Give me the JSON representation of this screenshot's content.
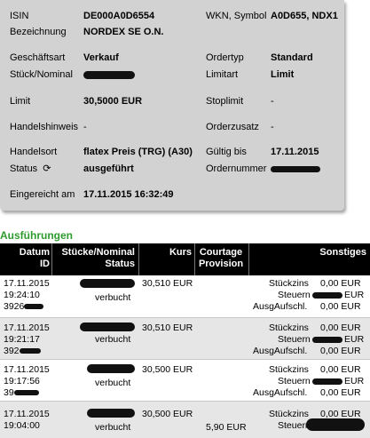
{
  "detail": {
    "isin_label": "ISIN",
    "isin_value": "DE000A0D6554",
    "wkn_label": "WKN, Symbol",
    "wkn_value": "A0D655, NDX1",
    "bezeichnung_label": "Bezeichnung",
    "bezeichnung_value": "NORDEX SE O.N.",
    "geschaeftsart_label": "Geschäftsart",
    "geschaeftsart_value": "Verkauf",
    "ordertyp_label": "Ordertyp",
    "ordertyp_value": "Standard",
    "stueck_label": "Stück/Nominal",
    "limitart_label": "Limitart",
    "limitart_value": "Limit",
    "limit_label": "Limit",
    "limit_value": "30,5000 EUR",
    "stoplimit_label": "Stoplimit",
    "stoplimit_value": "-",
    "handelshinweis_label": "Handelshinweis",
    "handelshinweis_value": "-",
    "orderzusatz_label": "Orderzusatz",
    "orderzusatz_value": "-",
    "handelsort_label": "Handelsort",
    "handelsort_value": "flatex Preis (TRG) (A30)",
    "gueltig_label": "Gültig bis",
    "gueltig_value": "17.11.2015",
    "status_label": "Status",
    "status_value": "ausgeführt",
    "ordernummer_label": "Ordernummer",
    "eingereicht_label": "Eingereicht am",
    "eingereicht_value": "17.11.2015 16:32:49",
    "status_icon": "refresh-icon"
  },
  "executions": {
    "title": "Ausführungen",
    "headers": {
      "datum": "Datum",
      "id": "ID",
      "stuecke": "Stücke/Nominal",
      "status": "Status",
      "kurs": "Kurs",
      "courtage": "Courtage",
      "provision": "Provision",
      "sonstiges": "Sonstiges"
    },
    "rows": [
      {
        "date": "17.11.2015",
        "time": "19:24:10",
        "id_prefix": "3926",
        "status": "verbucht",
        "kurs": "30,510 EUR",
        "courtage": "",
        "stueckzins_label": "Stückzins",
        "stueckzins_value": "0,00 EUR",
        "steuern_label": "Steuern",
        "steuern_value": "EUR",
        "ausgaufschl_label": "AusgAufschl.",
        "ausgaufschl_value": "0,00 EUR"
      },
      {
        "date": "17.11.2015",
        "time": "19:21:17",
        "id_prefix": "392",
        "status": "verbucht",
        "kurs": "30,510 EUR",
        "courtage": "",
        "stueckzins_label": "Stückzins",
        "stueckzins_value": "0,00 EUR",
        "steuern_label": "Steuern",
        "steuern_value": "EUR",
        "ausgaufschl_label": "AusgAufschl.",
        "ausgaufschl_value": "0,00 EUR"
      },
      {
        "date": "17.11.2015",
        "time": "19:17:56",
        "id_prefix": "39",
        "status": "verbucht",
        "kurs": "30,500 EUR",
        "courtage": "",
        "stueckzins_label": "Stückzins",
        "stueckzins_value": "0,00 EUR",
        "steuern_label": "Steuern",
        "steuern_value": "EUR",
        "ausgaufschl_label": "AusgAufschl.",
        "ausgaufschl_value": "0,00 EUR"
      },
      {
        "date": "17.11.2015",
        "time": "19:04:00",
        "id_prefix": "",
        "status": "verbucht",
        "kurs": "30,500 EUR",
        "courtage": "5,90 EUR",
        "stueckzins_label": "Stückzins",
        "stueckzins_value": "0,00 EUR",
        "steuern_label": "Steuern",
        "steuern_value": "",
        "ausgaufschl_label": "",
        "ausgaufschl_value": ""
      }
    ]
  },
  "colors": {
    "panel_bg": "#d2d2d2",
    "section_title": "#2e9b2e",
    "table_header_bg": "#000000",
    "alt_row_bg": "#e6e6e6"
  }
}
